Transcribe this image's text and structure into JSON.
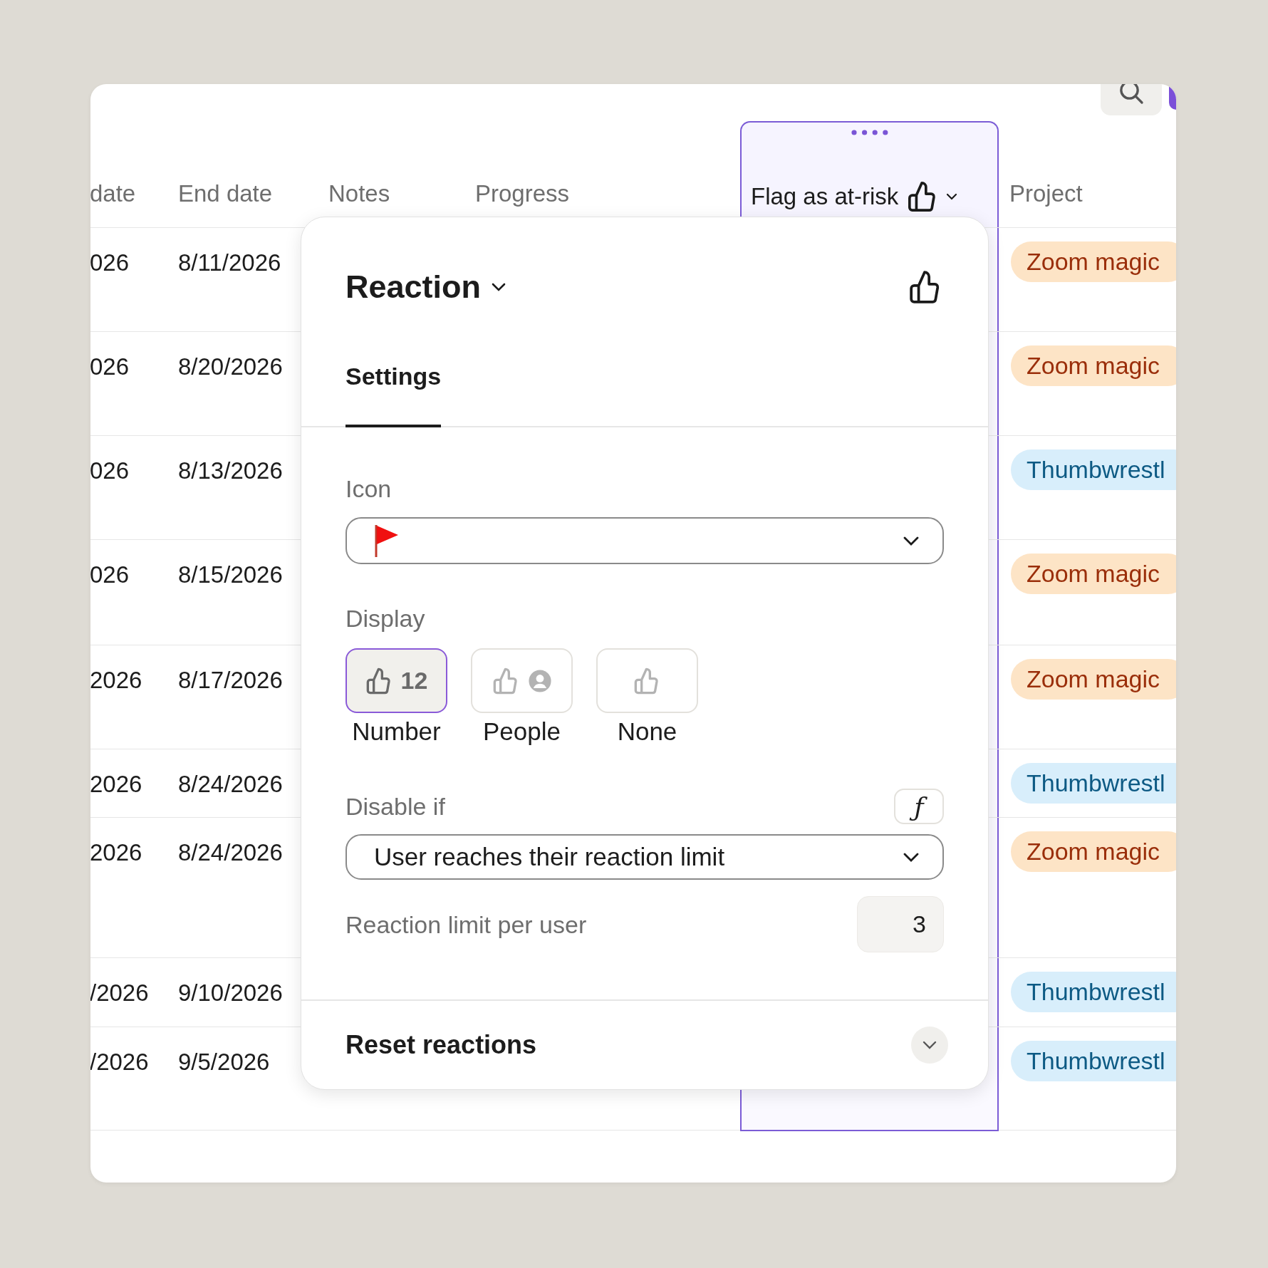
{
  "table": {
    "columns": [
      {
        "label": "date",
        "selected": false
      },
      {
        "label": "End date",
        "selected": false
      },
      {
        "label": "Notes",
        "selected": false
      },
      {
        "label": "Progress",
        "selected": false
      },
      {
        "label": "Flag as at-risk",
        "selected": true
      },
      {
        "label": "Project",
        "selected": false
      }
    ],
    "rows": [
      {
        "start": "026",
        "end": "8/11/2026",
        "project": {
          "label": "Zoom magic",
          "color": "#fde4c6"
        }
      },
      {
        "start": "026",
        "end": "8/20/2026",
        "project": {
          "label": "Zoom magic",
          "color": "#fde4c6"
        }
      },
      {
        "start": "026",
        "end": "8/13/2026",
        "project": {
          "label": "Thumbwrestl",
          "color": "#d8eefb"
        }
      },
      {
        "start": "026",
        "end": "8/15/2026",
        "project": {
          "label": "Zoom magic",
          "color": "#fde4c6"
        }
      },
      {
        "start": "2026",
        "end": "8/17/2026",
        "project": {
          "label": "Zoom magic",
          "color": "#fde4c6"
        }
      },
      {
        "start": "2026",
        "end": "8/24/2026",
        "project": {
          "label": "Thumbwrestl",
          "color": "#d8eefb"
        }
      },
      {
        "start": "2026",
        "end": "8/24/2026",
        "project": {
          "label": "Zoom magic",
          "color": "#fde4c6"
        }
      },
      {
        "start": "/2026",
        "end": "9/10/2026",
        "project": {
          "label": "Thumbwrestl",
          "color": "#d8eefb"
        }
      },
      {
        "start": "/2026",
        "end": "9/5/2026",
        "project": {
          "label": "Thumbwrestl",
          "color": "#d8eefb"
        }
      }
    ]
  },
  "popover": {
    "title": "Reaction",
    "tabs": [
      {
        "label": "Settings",
        "selected": true
      }
    ],
    "icon_field": {
      "label": "Icon"
    },
    "display": {
      "label": "Display",
      "options": [
        {
          "label": "Number",
          "kind": "number",
          "count": "12",
          "selected": true
        },
        {
          "label": "People",
          "kind": "people",
          "selected": false
        },
        {
          "label": "None",
          "kind": "none",
          "selected": false
        }
      ]
    },
    "disable_if": {
      "label": "Disable if",
      "formula_button": "ƒ",
      "value": "User reaches their reaction limit"
    },
    "limit": {
      "label": "Reaction limit per user",
      "value": "3"
    },
    "reset": {
      "label": "Reset reactions",
      "expanded": false
    }
  }
}
